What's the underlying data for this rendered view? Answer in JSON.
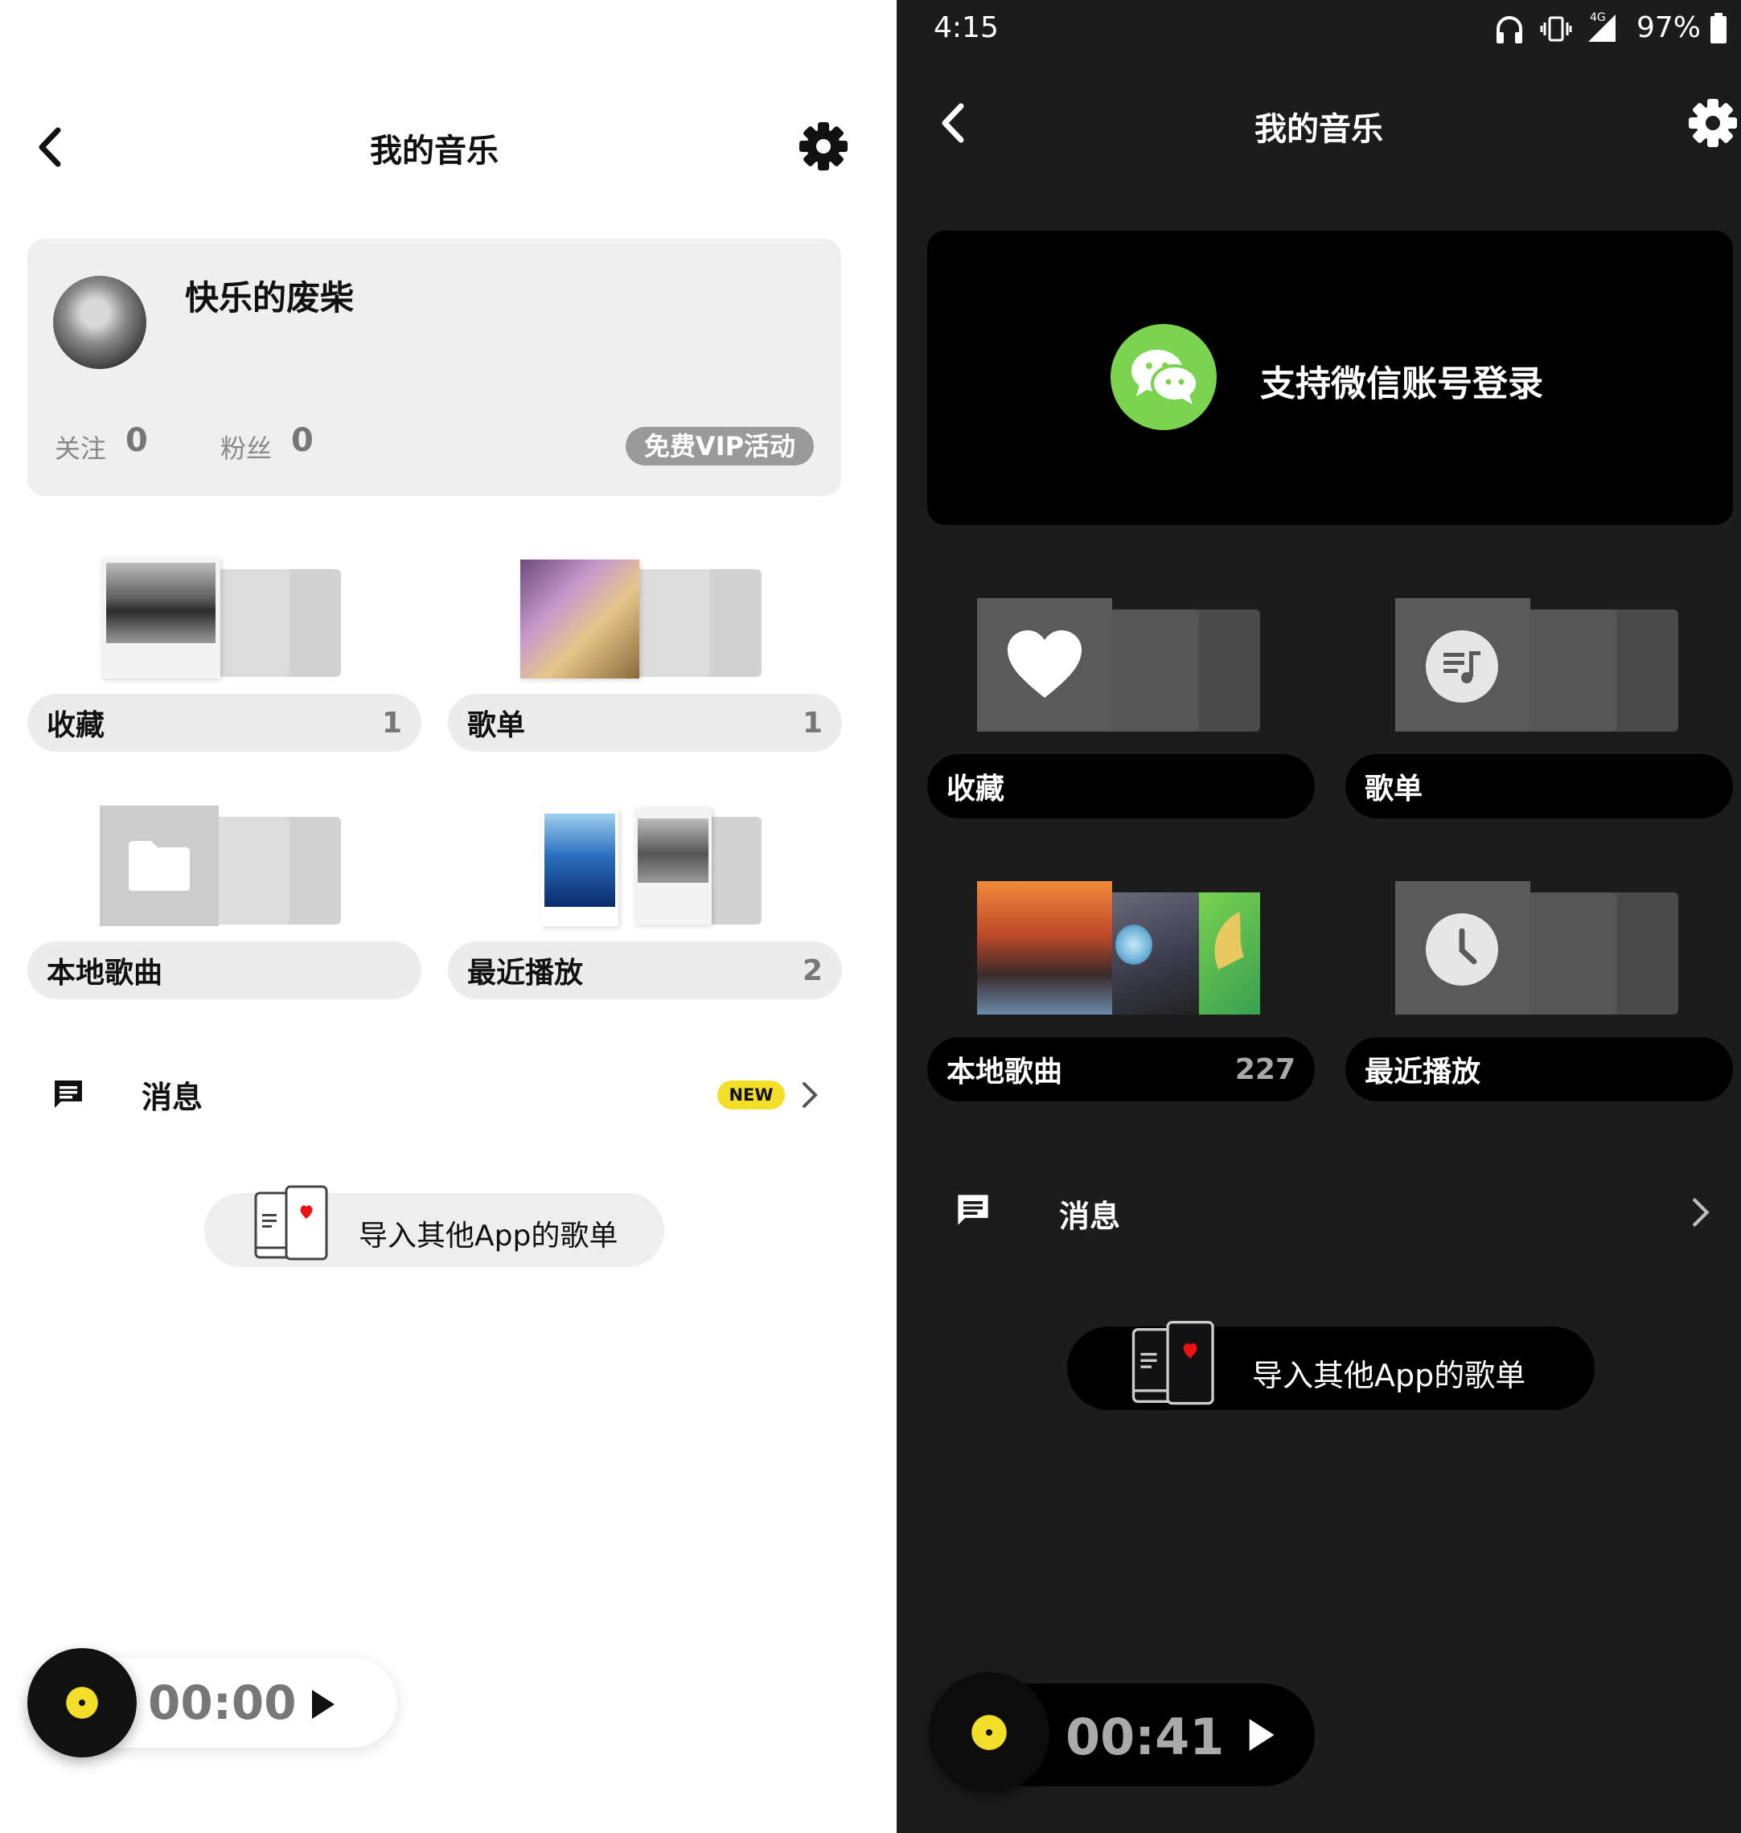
{
  "light": {
    "header": {
      "title": "我的音乐"
    },
    "profile": {
      "username": "快乐的废柴",
      "following_label": "关注",
      "following_count": "0",
      "fans_label": "粉丝",
      "fans_count": "0",
      "vip_badge": "免费VIP活动"
    },
    "tiles": [
      {
        "label": "收藏",
        "count": "1"
      },
      {
        "label": "歌单",
        "count": "1"
      },
      {
        "label": "本地歌曲",
        "count": ""
      },
      {
        "label": "最近播放",
        "count": "2"
      }
    ],
    "messages": {
      "label": "消息",
      "badge": "NEW"
    },
    "import_label": "导入其他App的歌单",
    "player": {
      "time": "00:00"
    }
  },
  "dark": {
    "status": {
      "time": "4:15",
      "network": "4G",
      "battery": "97%"
    },
    "header": {
      "title": "我的音乐"
    },
    "login": {
      "text": "支持微信账号登录"
    },
    "tiles": [
      {
        "label": "收藏",
        "count": ""
      },
      {
        "label": "歌单",
        "count": ""
      },
      {
        "label": "本地歌曲",
        "count": "227"
      },
      {
        "label": "最近播放",
        "count": ""
      }
    ],
    "messages": {
      "label": "消息"
    },
    "import_label": "导入其他App的歌单",
    "player": {
      "time": "00:41"
    }
  },
  "colors": {
    "accent_yellow": "#f3df2a",
    "wechat_green": "#7bd450"
  }
}
